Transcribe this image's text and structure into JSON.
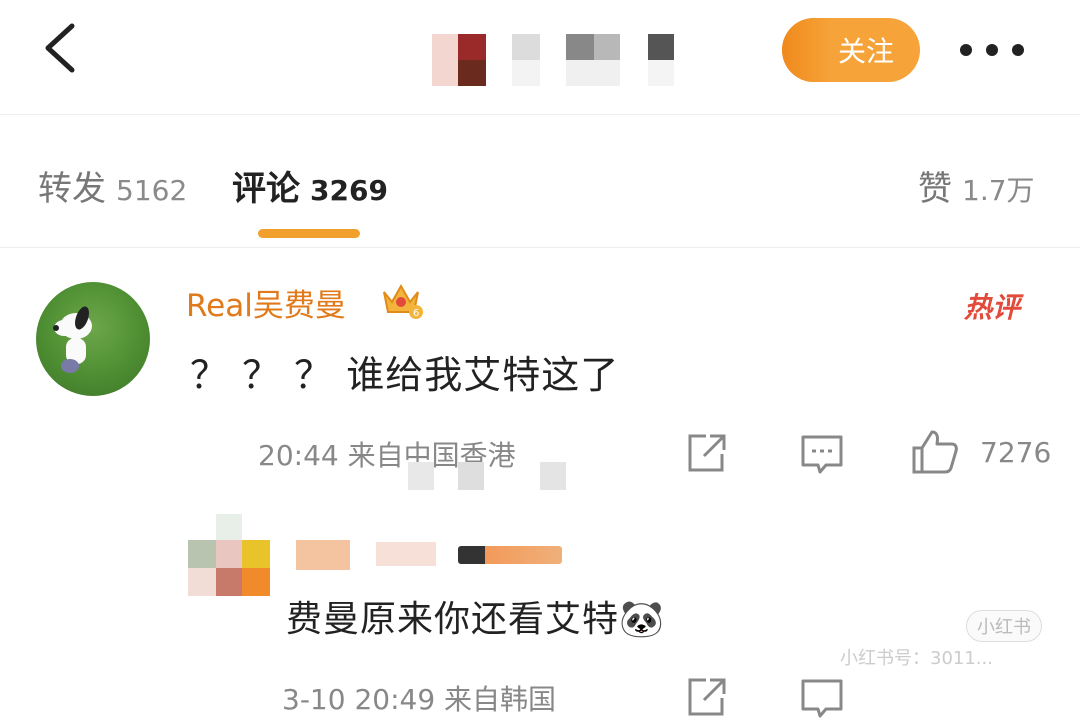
{
  "header": {
    "follow_label": "关注"
  },
  "tabs": [
    {
      "label": "转发",
      "count": "5162"
    },
    {
      "label": "评论",
      "count": "3269"
    },
    {
      "label": "赞",
      "count": "1.7万"
    }
  ],
  "comment": {
    "username": "Real吴费曼",
    "hot_label": "热评",
    "text": "？ ？ ？ 谁给我艾特这了",
    "meta": "20:44  来自中国香港",
    "like_count": "7276"
  },
  "reply": {
    "text": "费曼原来你还看艾特🐼",
    "meta": "3-10 20:49  来自韩国"
  },
  "watermark": {
    "badge": "小红书",
    "line": "小红书号：3011..."
  },
  "icons": [
    "back-arrow-icon",
    "more-dots-icon",
    "vip-crown-icon",
    "share-icon",
    "comment-icon",
    "like-icon"
  ],
  "colors": {
    "accent": "#f2a02d",
    "username": "#e07a1a",
    "hot": "#e24b3b"
  }
}
